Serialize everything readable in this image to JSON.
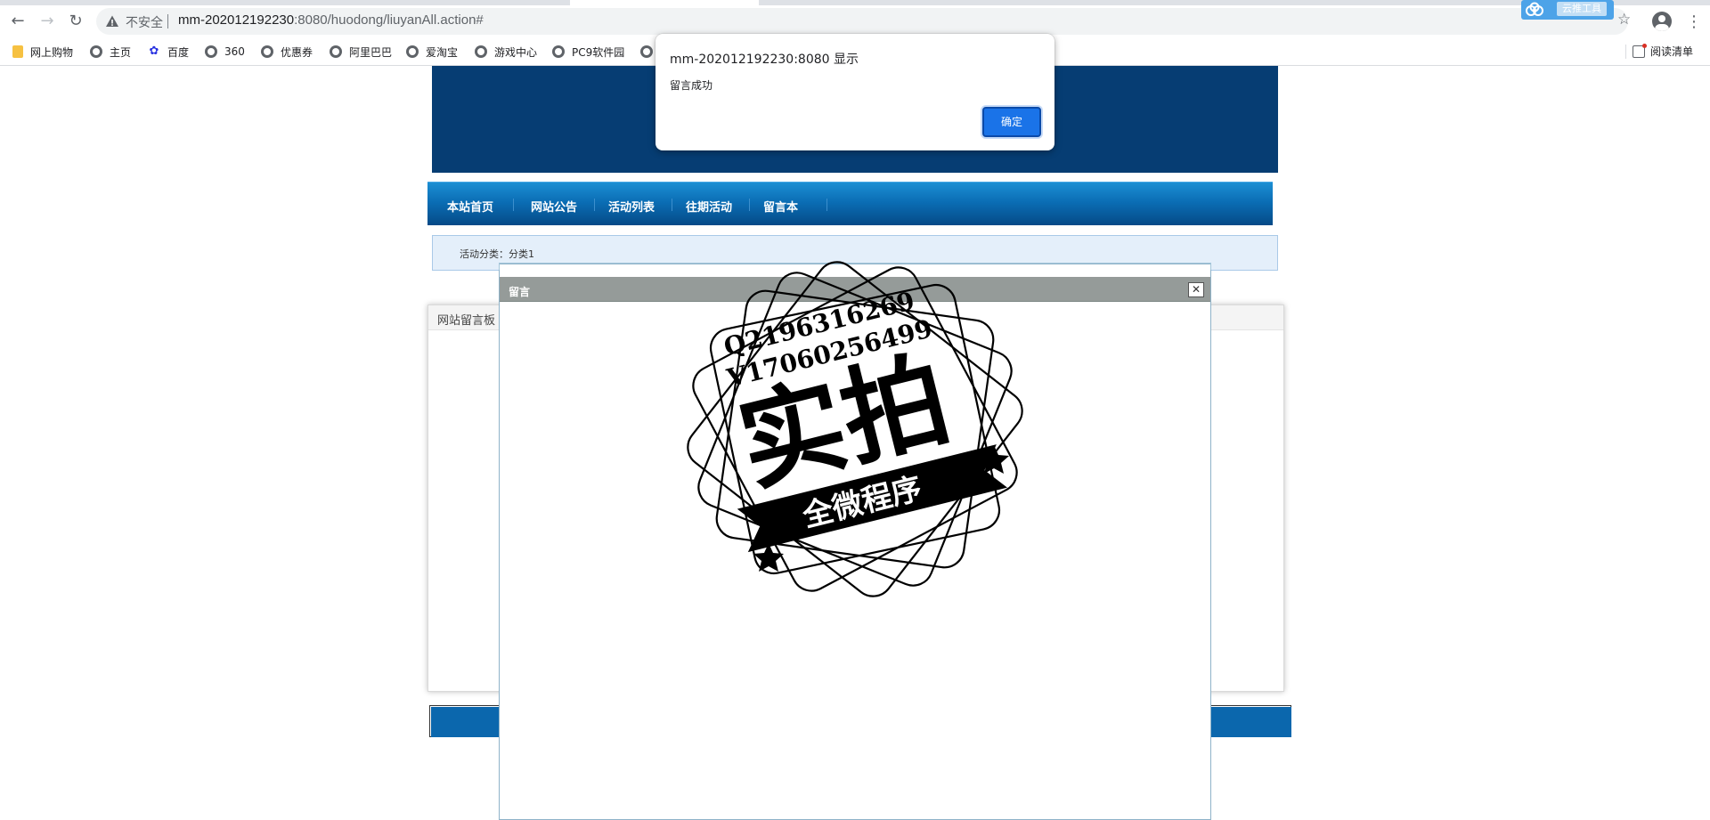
{
  "browser": {
    "security_label": "不安全",
    "url_host": "mm-202012192230",
    "url_path": ":8080/huodong/liuyanAll.action#",
    "back_icon": "arrow-left-icon",
    "forward_icon": "arrow-right-icon",
    "reload_icon": "reload-icon",
    "extension_label": "云推工具"
  },
  "bookmarks": [
    {
      "label": "网上购物",
      "icon": "folder-icon"
    },
    {
      "label": "主页",
      "icon": "globe-icon"
    },
    {
      "label": "百度",
      "icon": "paw-icon"
    },
    {
      "label": "360",
      "icon": "globe-icon"
    },
    {
      "label": "优惠券",
      "icon": "globe-icon"
    },
    {
      "label": "阿里巴巴",
      "icon": "globe-icon"
    },
    {
      "label": "爱淘宝",
      "icon": "globe-icon"
    },
    {
      "label": "游戏中心",
      "icon": "globe-icon"
    },
    {
      "label": "PC9软件园",
      "icon": "globe-icon"
    }
  ],
  "reading_list": "阅读清单",
  "nav": {
    "items": [
      "本站首页",
      "网站公告",
      "活动列表",
      "往期活动",
      "留言本"
    ]
  },
  "category": "活动分类：分类1",
  "board_title": "网站留言板",
  "dialog": {
    "title": "留言",
    "close": "✕"
  },
  "alert": {
    "title": "mm-202012192230:8080 显示",
    "message": "留言成功",
    "ok": "确定"
  },
  "watermark": {
    "line1": "Q2196316269",
    "line2": "V17060256499",
    "main": "实拍",
    "ribbon": "全微程序"
  },
  "colors": {
    "banner": "#063d73",
    "nav": "#0b6eb5",
    "alert_button": "#1a73e8"
  }
}
